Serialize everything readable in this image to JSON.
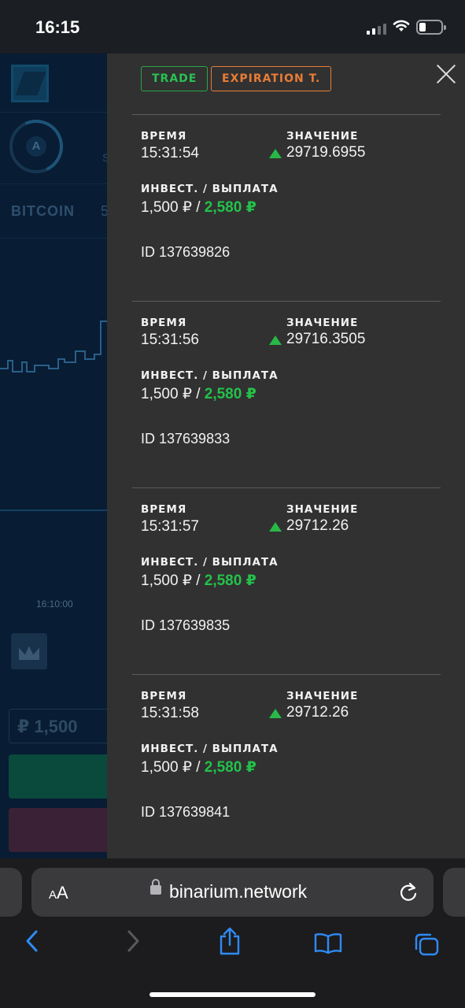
{
  "status_bar": {
    "time": "16:15",
    "battery_level": 0.2
  },
  "background_app": {
    "avatar_letter": "A",
    "fragment_s": "S",
    "asset": "BITCOIN",
    "asset_fragment": "5",
    "chart_time": "16:10:00",
    "amount": "₽ 1,500"
  },
  "panel": {
    "tabs": {
      "trade": "TRADE",
      "expiration": "EXPIRATION T."
    },
    "labels": {
      "time": "ВРЕМЯ",
      "value": "ЗНАЧЕНИЕ",
      "invest": "ИНВЕСТ. / ВЫПЛАТА"
    },
    "trades": [
      {
        "time": "15:31:54",
        "value": "29719.6955",
        "direction": "up",
        "invest": "1,500 ₽",
        "separator": " / ",
        "payout": "2,580 ₽",
        "id": "ID 137639826"
      },
      {
        "time": "15:31:56",
        "value": "29716.3505",
        "direction": "up",
        "invest": "1,500 ₽",
        "separator": " / ",
        "payout": "2,580 ₽",
        "id": "ID 137639833"
      },
      {
        "time": "15:31:57",
        "value": "29712.26",
        "direction": "up",
        "invest": "1,500 ₽",
        "separator": " / ",
        "payout": "2,580 ₽",
        "id": "ID 137639835"
      },
      {
        "time": "15:31:58",
        "value": "29712.26",
        "direction": "up",
        "invest": "1,500 ₽",
        "separator": " / ",
        "payout": "2,580 ₽",
        "id": "ID 137639841"
      }
    ]
  },
  "safari": {
    "aa_small": "A",
    "aa_big": "A",
    "url": "binarium.network"
  },
  "colors": {
    "trade_tab": "#28c152",
    "expiration_tab": "#e87d36",
    "payout": "#24c14a",
    "up_arrow": "#28b847",
    "panel_bg": "#313131"
  }
}
